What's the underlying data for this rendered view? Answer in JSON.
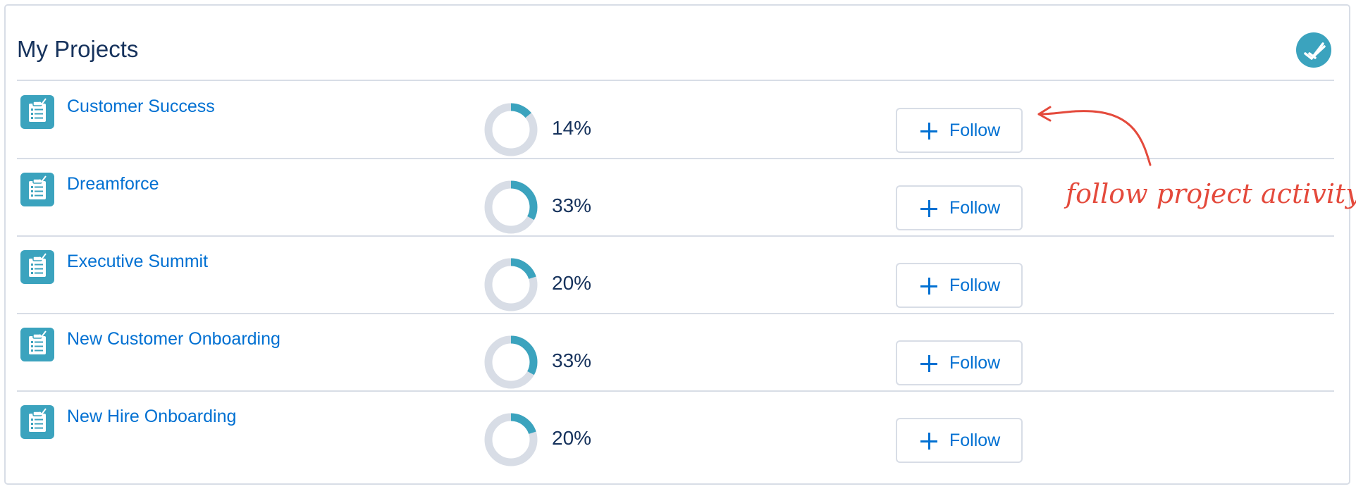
{
  "card": {
    "title": "My Projects",
    "header_icon": "double-check-icon"
  },
  "colors": {
    "accent": "#3ba3be",
    "link": "#0070d2",
    "text": "#16325c",
    "border": "#d8dde6",
    "donut_track": "#d8dde6",
    "annotation": "#e44a3c"
  },
  "projects": [
    {
      "name": "Customer Success",
      "progress_label": "14%",
      "progress": 0.14,
      "follow_label": "Follow",
      "icon": "project-checklist-icon"
    },
    {
      "name": "Dreamforce",
      "progress_label": "33%",
      "progress": 0.33,
      "follow_label": "Follow",
      "icon": "project-checklist-icon"
    },
    {
      "name": "Executive Summit",
      "progress_label": "20%",
      "progress": 0.2,
      "follow_label": "Follow",
      "icon": "project-checklist-icon"
    },
    {
      "name": "New Customer Onboarding",
      "progress_label": "33%",
      "progress": 0.33,
      "follow_label": "Follow",
      "icon": "project-checklist-icon"
    },
    {
      "name": "New Hire Onboarding",
      "progress_label": "20%",
      "progress": 0.2,
      "follow_label": "Follow",
      "icon": "project-checklist-icon"
    }
  ],
  "annotation": {
    "text": "follow project activity"
  }
}
